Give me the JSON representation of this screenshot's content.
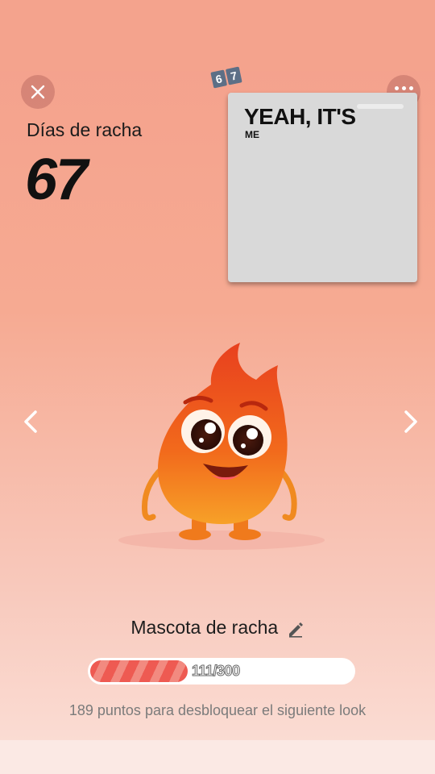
{
  "header": {
    "close_icon": "close-icon",
    "more_icon": "more-options-icon",
    "streak_label": "Días de racha",
    "streak_count": "67",
    "badge_digits": [
      "6",
      "7"
    ]
  },
  "overlay": {
    "title": "YEAH, IT'S",
    "subtitle": "ME"
  },
  "carousel": {
    "prev_icon": "chevron-left-icon",
    "next_icon": "chevron-right-icon"
  },
  "mascot": {
    "name": "Mascota de racha",
    "edit_icon": "pencil-icon",
    "progress_current": 111,
    "progress_total": 300,
    "progress_text": "111/300",
    "hint": "189 puntos para desbloquear el siguiente look"
  },
  "colors": {
    "background": "#f4a08c",
    "progress_fill": "#ee5a52",
    "flame": "#f26a1c"
  }
}
